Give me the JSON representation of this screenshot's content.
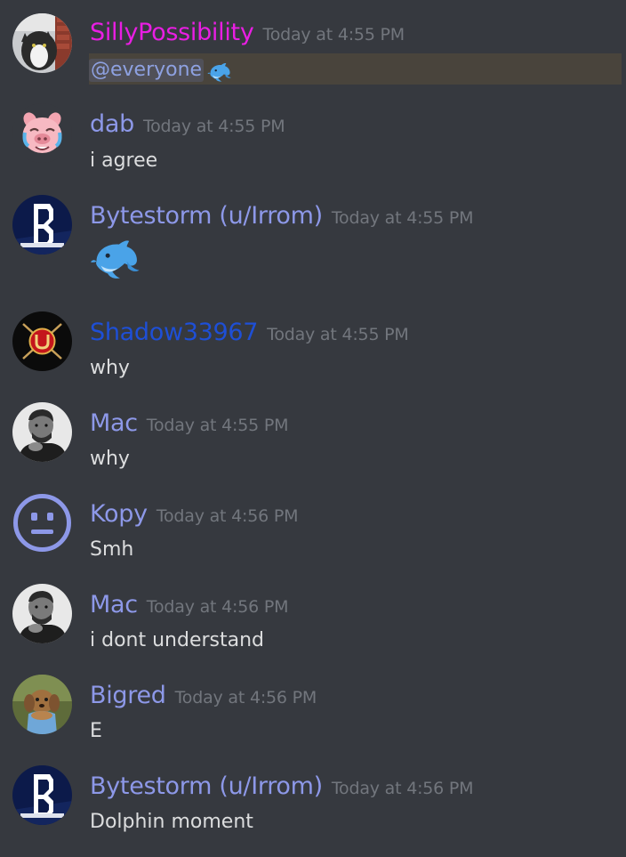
{
  "colors": {
    "background": "#36393f",
    "timestamp": "#72767d",
    "text": "#dcddde",
    "mention": "#8ea1e1",
    "mention_highlight": "#49443c",
    "role_pink": "#e91ee3",
    "role_blue": "#1e4fd6",
    "role_default": "#8d98e8"
  },
  "messages": [
    {
      "username": "SillyPossibility",
      "timestamp": "Today at 4:55 PM",
      "mention": "@everyone",
      "emoji": "dolphin-emoji",
      "avatar": "cat-photo-avatar"
    },
    {
      "username": "dab",
      "timestamp": "Today at 4:55 PM",
      "text": "i agree",
      "avatar": "crying-pig-avatar"
    },
    {
      "username": "Bytestorm (u/Irrom)",
      "timestamp": "Today at 4:55 PM",
      "emoji": "dolphin-emoji",
      "avatar": "bytestorm-logo-avatar"
    },
    {
      "username": "Shadow33967",
      "timestamp": "Today at 4:55 PM",
      "text": "why",
      "avatar": "shadow-emblem-avatar"
    },
    {
      "username": "Mac",
      "timestamp": "Today at 4:55 PM",
      "text": "why",
      "avatar": "bw-portrait-avatar"
    },
    {
      "username": "Kopy",
      "timestamp": "Today at 4:56 PM",
      "text": "Smh",
      "avatar": "neutral-face-avatar"
    },
    {
      "username": "Mac",
      "timestamp": "Today at 4:56 PM",
      "text": "i dont understand",
      "avatar": "bw-portrait-avatar"
    },
    {
      "username": "Bigred",
      "timestamp": "Today at 4:56 PM",
      "text": "E",
      "avatar": "dog-photo-avatar"
    },
    {
      "username": "Bytestorm (u/Irrom)",
      "timestamp": "Today at 4:56 PM",
      "text": "Dolphin moment",
      "avatar": "bytestorm-logo-avatar"
    }
  ]
}
